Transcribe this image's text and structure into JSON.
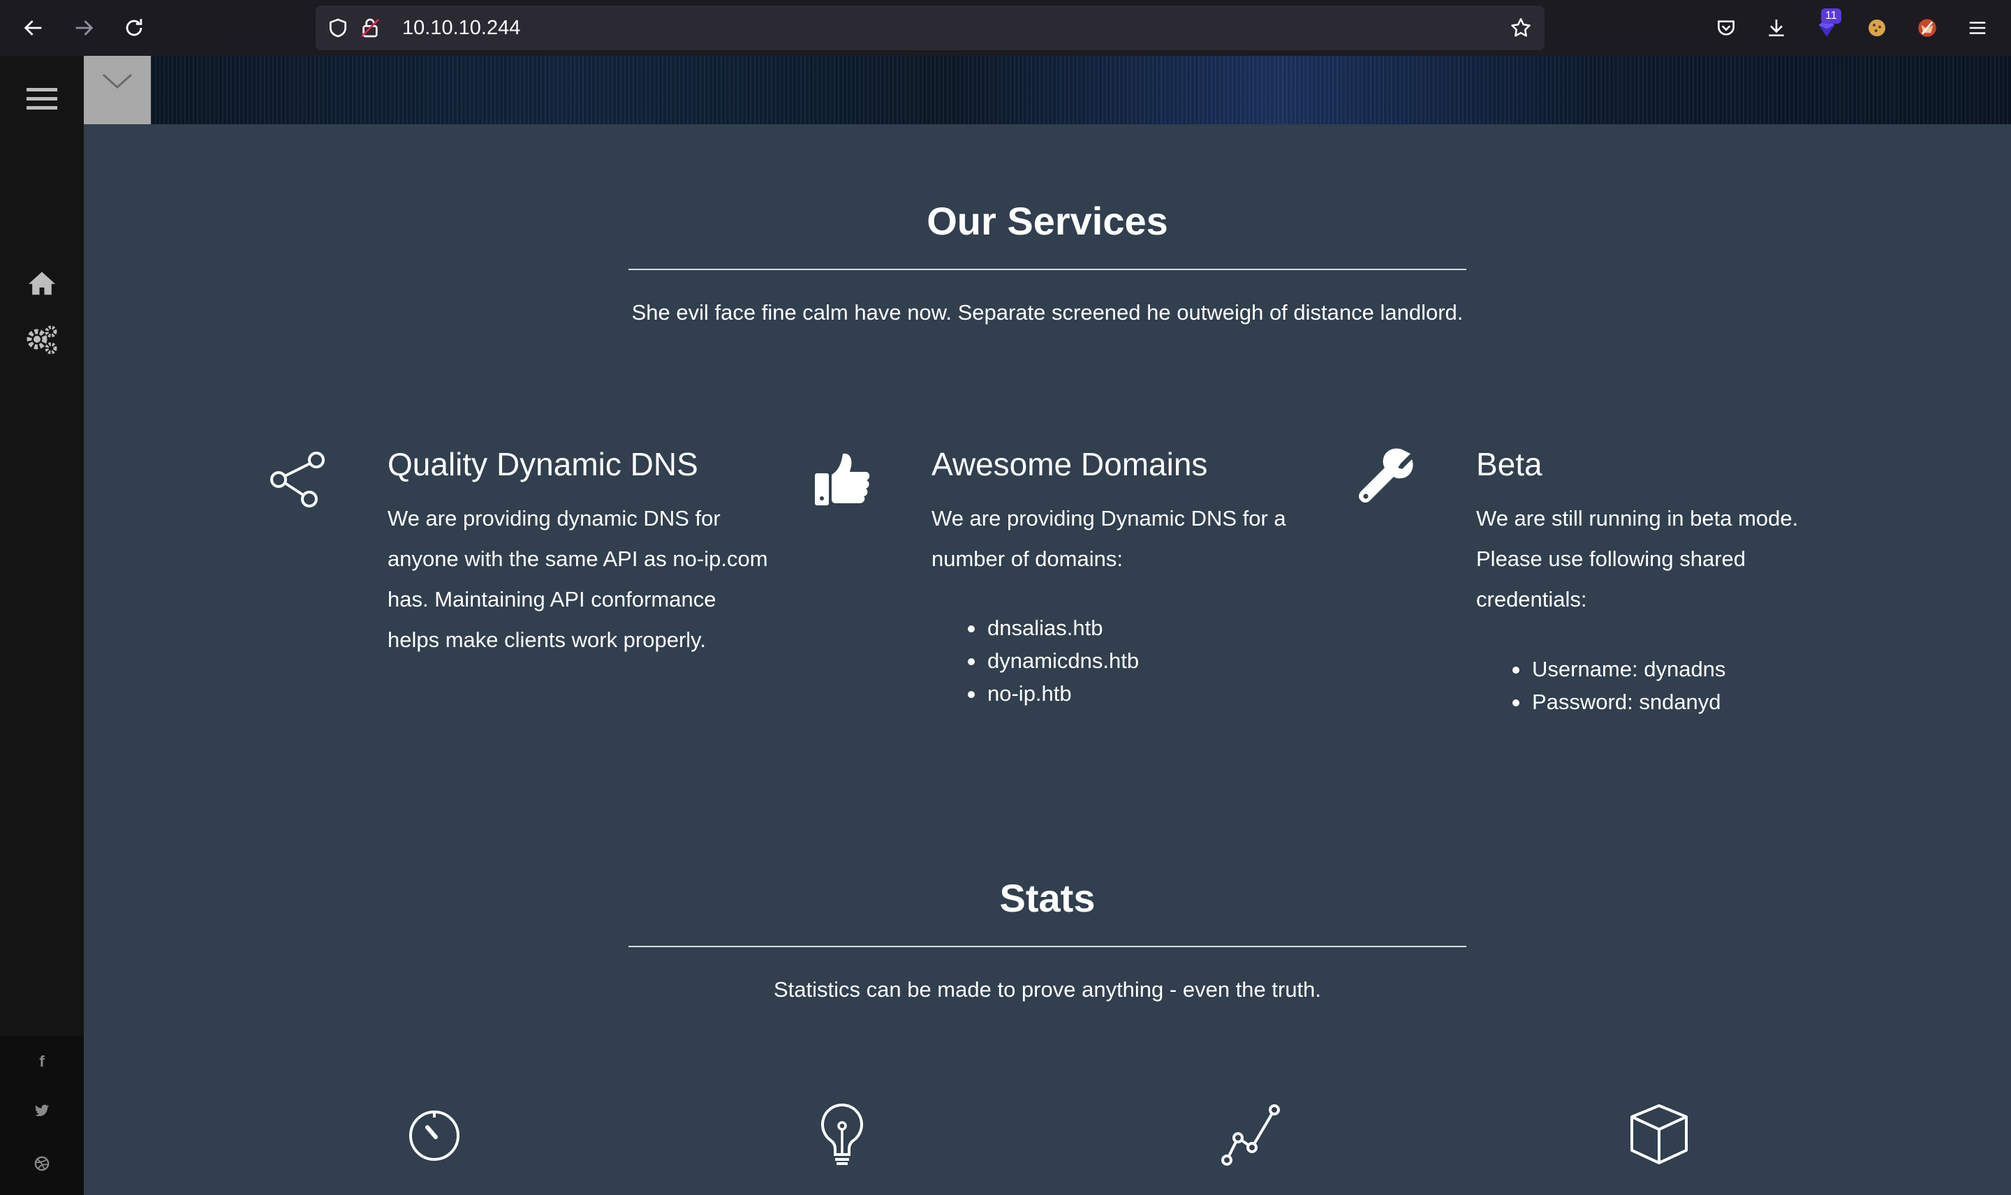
{
  "browser": {
    "url": "10.10.10.244",
    "extension_badge": "11"
  },
  "sidebar": {
    "items": [
      {
        "icon": "home-icon"
      },
      {
        "icon": "gears-icon"
      }
    ],
    "social": [
      "f",
      "twitter",
      "dribbble"
    ]
  },
  "services": {
    "title": "Our Services",
    "subtitle": "She evil face fine calm have now. Separate screened he outweigh of distance landlord.",
    "items": [
      {
        "icon": "share-icon",
        "title": "Quality Dynamic DNS",
        "lines": [
          "We are providing dynamic DNS for",
          "anyone with the same API as no-ip.com",
          "has. Maintaining API conformance",
          "helps make clients work properly."
        ],
        "list": []
      },
      {
        "icon": "thumbs-up-icon",
        "title": "Awesome Domains",
        "lines": [
          "We are providing Dynamic DNS for a",
          "number of domains:"
        ],
        "list": [
          "dnsalias.htb",
          "dynamicdns.htb",
          "no-ip.htb"
        ]
      },
      {
        "icon": "wrench-icon",
        "title": "Beta",
        "lines": [
          "We are still running in beta mode.",
          "Please use following shared",
          "credentials:"
        ],
        "list": [
          "Username: dynadns",
          "Password: sndanyd"
        ]
      }
    ]
  },
  "stats": {
    "title": "Stats",
    "subtitle": "Statistics can be made to prove anything - even the truth.",
    "icons": [
      "stopwatch-icon",
      "lightbulb-icon",
      "line-graph-icon",
      "cube-icon"
    ]
  }
}
